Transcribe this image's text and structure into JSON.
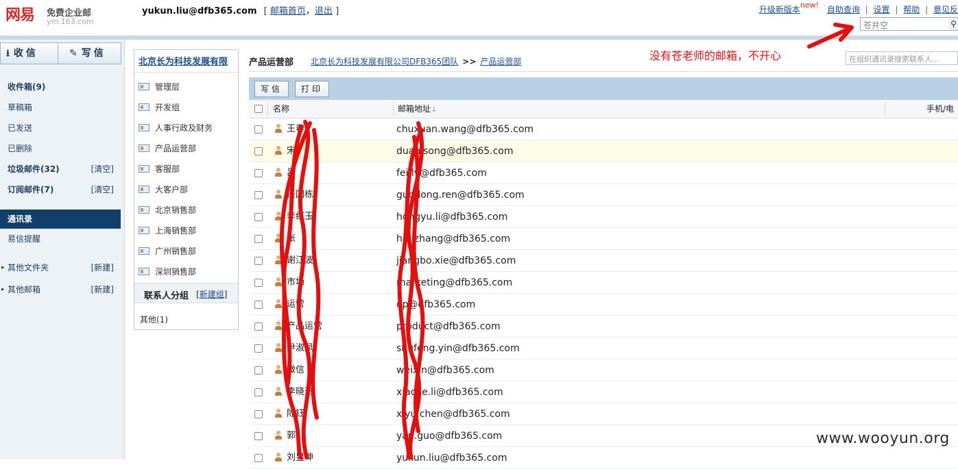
{
  "header": {
    "logo_brand": "网易",
    "logo_product": "免费企业邮",
    "logo_domain": "ym.163.com",
    "user_email": "yukun.liu@dfb365.com",
    "user_links_open": "[",
    "mailbox_home": "邮箱首页",
    "user_links_comma": "，",
    "logout": "退出",
    "user_links_close": "]",
    "top_links": {
      "upgrade": "升级新版本",
      "new_badge": "new!",
      "self_service": "自助查询",
      "settings": "设置",
      "help": "帮助",
      "feedback": "意见反",
      "separator": "|"
    },
    "search_value": "苍井空",
    "search_icon": "magnifier-icon"
  },
  "left_nav": {
    "receive": "收信",
    "compose": "写信",
    "items": [
      {
        "label": "收件箱(9)",
        "bold": true
      },
      {
        "label": "草稿箱"
      },
      {
        "label": "已发送"
      },
      {
        "label": "已删除"
      },
      {
        "label": "垃圾邮件(32)",
        "bold": true,
        "action": "[清空]"
      },
      {
        "label": "订阅邮件(7)",
        "bold": true,
        "action": "[清空]"
      },
      {
        "label": "通讯录",
        "active": true
      },
      {
        "label": "易信提醒"
      },
      {
        "label": "其他文件夹",
        "action": "[新建]"
      },
      {
        "label": "其他邮箱",
        "action": "[新建]"
      }
    ]
  },
  "org_tree": {
    "title": "北京长为科技发展有限",
    "departments": [
      "管理层",
      "开发组",
      "人事行政及财务",
      "产品运营部",
      "客服部",
      "大客户部",
      "北京销售部",
      "上海销售部",
      "广州销售部",
      "深圳销售部"
    ],
    "group_title": "联系人分组",
    "group_new_open": "[",
    "group_new": "新建组",
    "group_new_close": "]",
    "group_other": "其他(1)"
  },
  "main": {
    "dept_title": "产品运营部",
    "crumb_company": "北京长为科技发展有限公司DFB365团队",
    "crumb_sep": ">>",
    "crumb_dept": "产品运营部",
    "contact_search_placeholder": "在组织通讯录搜索联系人...",
    "toolbar": {
      "compose": "写信",
      "print": "打印"
    },
    "columns": {
      "name": "名称",
      "email": "邮箱地址",
      "phone": "手机/电"
    },
    "rows": [
      {
        "name": "王春",
        "email": "chuxuan.wang@dfb365.com"
      },
      {
        "name": "宋",
        "email": "duanjsong@dfb365.com"
      },
      {
        "name": "吕",
        "email": "fei.lv@dfb365.com"
      },
      {
        "name": "任国栋",
        "email": "guodong.ren@dfb365.com"
      },
      {
        "name": "李红玉",
        "email": "hongyu.li@dfb365.com"
      },
      {
        "name": "张",
        "email": "hai.zhang@dfb365.com"
      },
      {
        "name": "谢江波",
        "email": "jiangbo.xie@dfb365.com"
      },
      {
        "name": "市场",
        "email": "marketing@dfb365.com"
      },
      {
        "name": "运营",
        "email": "op@dfb365.com"
      },
      {
        "name": "产品运营",
        "email": "product@dfb365.com"
      },
      {
        "name": "尹淑凤",
        "email": "shufeng.yin@dfb365.com"
      },
      {
        "name": "微信",
        "email": "weixin@dfb365.com"
      },
      {
        "name": "李晓洁",
        "email": "xiaojie.li@dfb365.com"
      },
      {
        "name": "陈钰",
        "email": "xiyu.chen@dfb365.com"
      },
      {
        "name": "郭",
        "email": "yan.guo@dfb365.com"
      },
      {
        "name": "刘昱坤",
        "email": "yukun.liu@dfb365.com"
      }
    ]
  },
  "annotation": {
    "text": "没有苍老师的邮箱，不开心",
    "color": "#e4100f"
  },
  "watermark": "www.wooyun.org"
}
